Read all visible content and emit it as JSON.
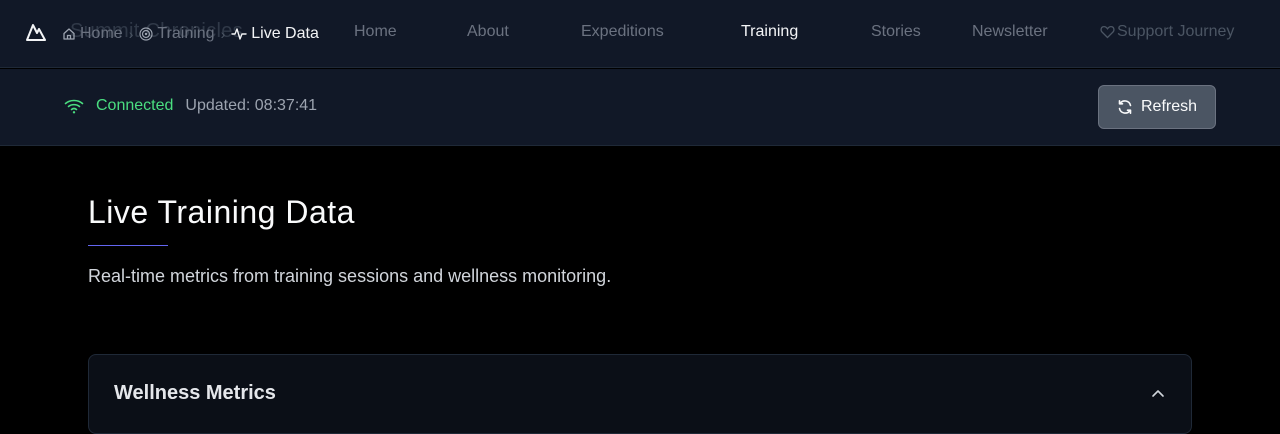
{
  "site": {
    "name": "Summit Chronicles"
  },
  "breadcrumb": [
    {
      "label": "Home",
      "icon": "home-icon"
    },
    {
      "label": "Training",
      "icon": "target-icon"
    },
    {
      "label": "Live Data",
      "icon": "activity-icon"
    }
  ],
  "nav": {
    "items": [
      "Home",
      "About",
      "Expeditions",
      "Training",
      "Stories",
      "Newsletter"
    ],
    "active": "Training",
    "support_label": "Support Journey"
  },
  "status": {
    "connection": "Connected",
    "updated": "Updated: 08:37:41",
    "refresh_label": "Refresh"
  },
  "page": {
    "title": "Live Training Data",
    "subtitle": "Real-time metrics from training sessions and wellness monitoring."
  },
  "panel": {
    "title": "Wellness Metrics"
  },
  "colors": {
    "accent": "#6366f1",
    "connected": "#4ade80",
    "topbar_bg": "#111827"
  }
}
